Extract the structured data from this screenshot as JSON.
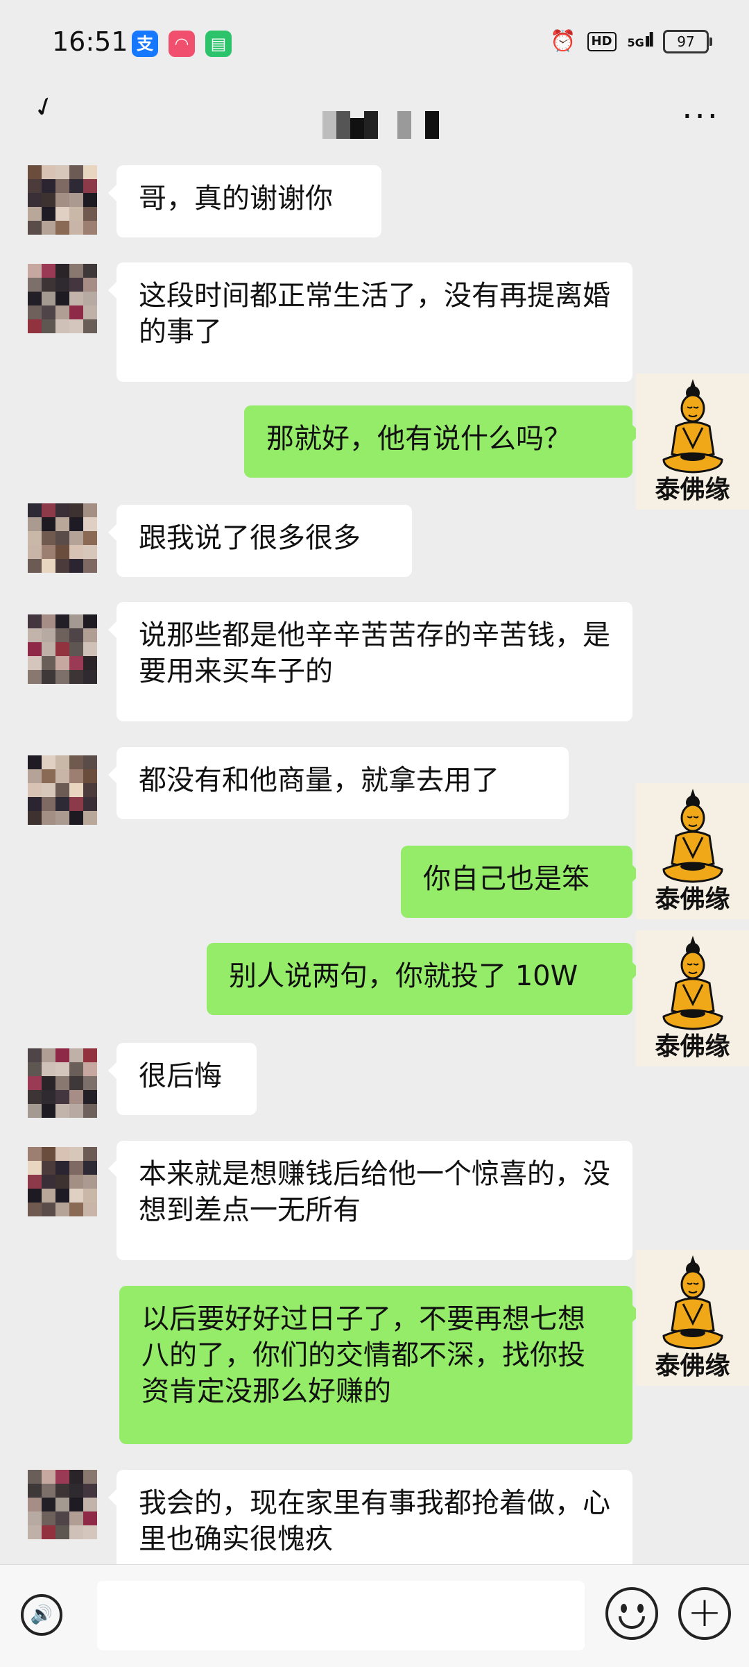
{
  "status_bar": {
    "time": "16:51",
    "hd": "HD",
    "network": "5G",
    "battery": "97"
  },
  "header": {
    "back_icon": "chevron-left-icon",
    "more_label": "···"
  },
  "contact_label": "泰佛缘",
  "messages": [
    {
      "side": "in",
      "text": "哥，真的谢谢你"
    },
    {
      "side": "in",
      "text": "这段时间都正常生活了，没有再提离婚的事了"
    },
    {
      "side": "out",
      "text": "那就好，他有说什么吗？"
    },
    {
      "side": "in",
      "text": "跟我说了很多很多"
    },
    {
      "side": "in",
      "text": "说那些都是他辛辛苦苦存的辛苦钱，是要用来买车子的"
    },
    {
      "side": "in",
      "text": "都没有和他商量，就拿去用了"
    },
    {
      "side": "out",
      "text": "你自己也是笨"
    },
    {
      "side": "out",
      "text": "别人说两句，你就投了 10W"
    },
    {
      "side": "in",
      "text": "很后悔"
    },
    {
      "side": "in",
      "text": "本来就是想赚钱后给他一个惊喜的，没想到差点一无所有"
    },
    {
      "side": "out",
      "text": "以后要好好过日子了，不要再想七想八的了，你们的交情都不深，找你投资肯定没那么好赚的"
    },
    {
      "side": "in",
      "text": "我会的，现在家里有事我都抢着做，心里也确实很愧疚"
    }
  ],
  "input_bar": {
    "placeholder": "",
    "voice_icon": "voice-icon",
    "emoji_icon": "emoji-icon",
    "plus_icon": "plus-icon"
  },
  "colors": {
    "background": "#ededed",
    "outgoing_bubble": "#95ec69",
    "incoming_bubble": "#ffffff"
  }
}
